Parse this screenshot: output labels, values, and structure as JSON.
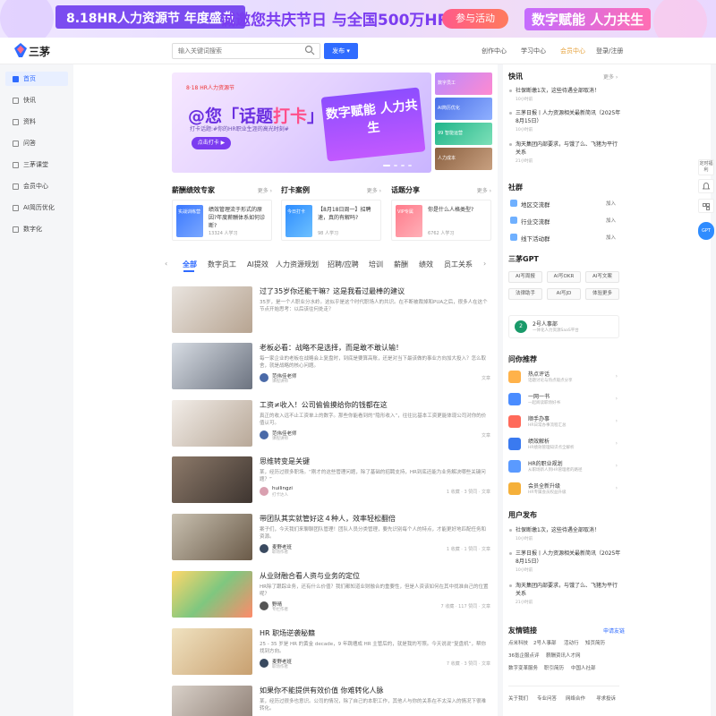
{
  "banner": {
    "left": "8.18HR人力资源节 年度盛典",
    "middle": "诚邀您共庆节日 与全国500万HR共成长",
    "button": "参与活动",
    "right": "数字赋能 人力共生"
  },
  "header": {
    "logo": "三茅",
    "search_placeholder": "输入关键词搜索",
    "publish": "发布 ▾",
    "nav": [
      "创作中心",
      "学习中心",
      "会员中心",
      "登录/注册"
    ]
  },
  "sidebar": [
    "首页",
    "快讯",
    "资料",
    "问答",
    "三茅课堂",
    "会员中心",
    "AI简历优化",
    "数字化"
  ],
  "hero": {
    "tag": "@您「话题打卡」",
    "tag_pre": "@您「话题",
    "tag_em": "打卡",
    "tag_post": "」",
    "sub": "打卡话题:#你的HR职业生涯的高光时刻#",
    "btn": "点击打卡 ▶",
    "art": "数字赋能 人力共生",
    "brand": "8·18 HR人力资源节"
  },
  "thumbs": [
    "数字员工",
    "AI简历优化",
    "99 智能运营",
    "人力成本"
  ],
  "sections": [
    {
      "title": "薪酬绩效专家",
      "more": "更多 ›",
      "img": "实战训练营",
      "text": "绩效管理流于形式的原因?年度薪酬体系如何诊断?",
      "meta": "13324 人学习"
    },
    {
      "title": "打卡案例",
      "more": "更多 ›",
      "img": "今日打卡",
      "text": "【8月18日周一】招聘速，真的有解吗?",
      "meta": "98 人学习"
    },
    {
      "title": "话题分享",
      "more": "更多 ›",
      "img": "VIP专属",
      "text": "你是什么人格类型?",
      "meta": "6762 人学习"
    }
  ],
  "tabs": [
    "全部",
    "数字员工",
    "AI提效",
    "人力资源规划",
    "招聘/应聘",
    "培训",
    "薪酬",
    "绩效",
    "员工关系"
  ],
  "articles": [
    {
      "title": "过了35岁你还能干嘛？这是我看过最棒的建议",
      "desc": "35岁，是一个人职业分水岭。这似乎是这个时代职场人的共识。在不断被裁掉和PUA之后，很多人在这个节点开始思考：以后该往何处走？",
      "author": "",
      "role": "",
      "stats": ""
    },
    {
      "title": "老板必看：战略不是选择，而是敢不敢认输！",
      "desc": "每一家企业的老板在战略会上复盘时，到底是要算高账，还是对当下最该做的事业方向加大投入？怎么取舍，就是战略的核心问题。",
      "author": "范伟佳老师",
      "role": "课程讲师",
      "stats": "文章"
    },
    {
      "title": "工资≠收入！公司偷偷摸给你的钱都在这",
      "desc": "真正的收入远不止工资单上的数字。那些你能看到的“隐形收入”，往往比基本工资更能体现公司对你的价值认可。",
      "author": "范伟佳老师",
      "role": "课程讲师",
      "stats": "文章"
    },
    {
      "title": "思维转变是关键",
      "desc": "某，经历过很多职场。“刚才的这些管理问题，除了基础的招聘支持，HR到底还能为业务解决哪些关键问题？”",
      "author": "huilingzi",
      "role": "打卡达人",
      "stats": "1 收藏 · 3 赞同 · 文章"
    },
    {
      "title": "带团队其实就管好这４种人，效率轻松翻倍",
      "desc": "案子们，今天我们来聊聊团队管理！团队人员分类管理，要先识别每个人的特点，才能更好地匹配任务和资源。",
      "author": "麦野老班",
      "role": "职场作者",
      "stats": "1 收藏 · 1 赞同 · 文章"
    },
    {
      "title": "从业财融合看人资与业务的定位",
      "desc": "HR除了跟踪业务，还有什么价值？我们都知道业财融合的重要性，但是人资该如何在其中找准自己的位置呢？",
      "author": "野晴",
      "role": "专栏作者",
      "stats": "7 收藏 · 117 赞同 · 文章"
    },
    {
      "title": "HR 职场逆袭秘籍",
      "desc": "25 - 35 岁是 HR 的黄金 decade，9 年跳槽成 HR 主管后的，就是我的写照。今天说说“复盘机”，帮你找到方向。",
      "author": "麦野老班",
      "role": "职场作者",
      "stats": "7 收藏 · 3 赞同 · 文章"
    },
    {
      "title": "如果你不能提供有效价值 你难转化人脉",
      "desc": "某，经历过很多也意识。公司的情况，除了自己的本职工作，其他人与你的关系在不太深入的情况下很难转化。",
      "author": "",
      "role": "",
      "stats": ""
    }
  ],
  "right": {
    "kuaixun": {
      "title": "快讯",
      "more": "更多 ›",
      "items": [
        {
          "t": "社保断缴1次，这些待遇全部取消！",
          "d": "10小时前"
        },
        {
          "t": "三茅日报丨人力资源相关最新简讯（2025年8月15日）",
          "d": "10小时前"
        },
        {
          "t": "淘天集团内部要求，与饿了么、飞猪为平行关系",
          "d": "21小时前"
        }
      ]
    },
    "shequn": {
      "title": "社群",
      "items": [
        {
          "l": "地区交流群",
          "j": "加入"
        },
        {
          "l": "行业交流群",
          "j": "加入"
        },
        {
          "l": "线下活动群",
          "j": "加入"
        }
      ]
    },
    "gpt": {
      "title": "三茅GPT",
      "chips": [
        "AI写周报",
        "AI写OKR",
        "AI写文案",
        "法律助手",
        "AI写JD",
        "体验更多"
      ],
      "name": "2号人事部",
      "desc": "一体化人力资源SaaS平台"
    },
    "xiang": {
      "title": "问你推荐",
      "items": [
        {
          "a": "热点评话",
          "b": "话题讨论与热点观点分享"
        },
        {
          "a": "一网一书",
          "b": "一起阅读职场好书"
        },
        {
          "a": "顺手办事",
          "b": "HR日常办事流程汇总"
        },
        {
          "a": "绩效解析",
          "b": "HR绩效管理知识点全解析"
        },
        {
          "a": "HR的职业规划",
          "b": "从职场新人到HR管理者的路径"
        },
        {
          "a": "会员全新升级",
          "b": "HR专属会员权益升级"
        }
      ]
    },
    "userpub": {
      "title": "用户发布",
      "items": [
        {
          "t": "社保断缴1次，这些待遇全部取消！",
          "d": "10小时前"
        },
        {
          "t": "三茅日报丨人力资源相关最新简讯（2025年8月15日）",
          "d": "10小时前"
        },
        {
          "t": "淘天集团内部要求，与饿了么、飞猪为平行关系",
          "d": "21小时前"
        }
      ]
    },
    "links": {
      "title": "友情链接",
      "more": "申请友链",
      "items": [
        "点米科技",
        "2号人事部",
        "活动行",
        "知页简历",
        "36氪企服点评",
        "薪酬资讯人才网",
        "数字变革服务",
        "职引简历",
        "中国人社部"
      ]
    },
    "footer": [
      "关于我们",
      "专业问答",
      "网络合作",
      "寻求投诉"
    ]
  },
  "float": [
    "定时福利",
    "通知",
    "二维码",
    "GPT"
  ]
}
